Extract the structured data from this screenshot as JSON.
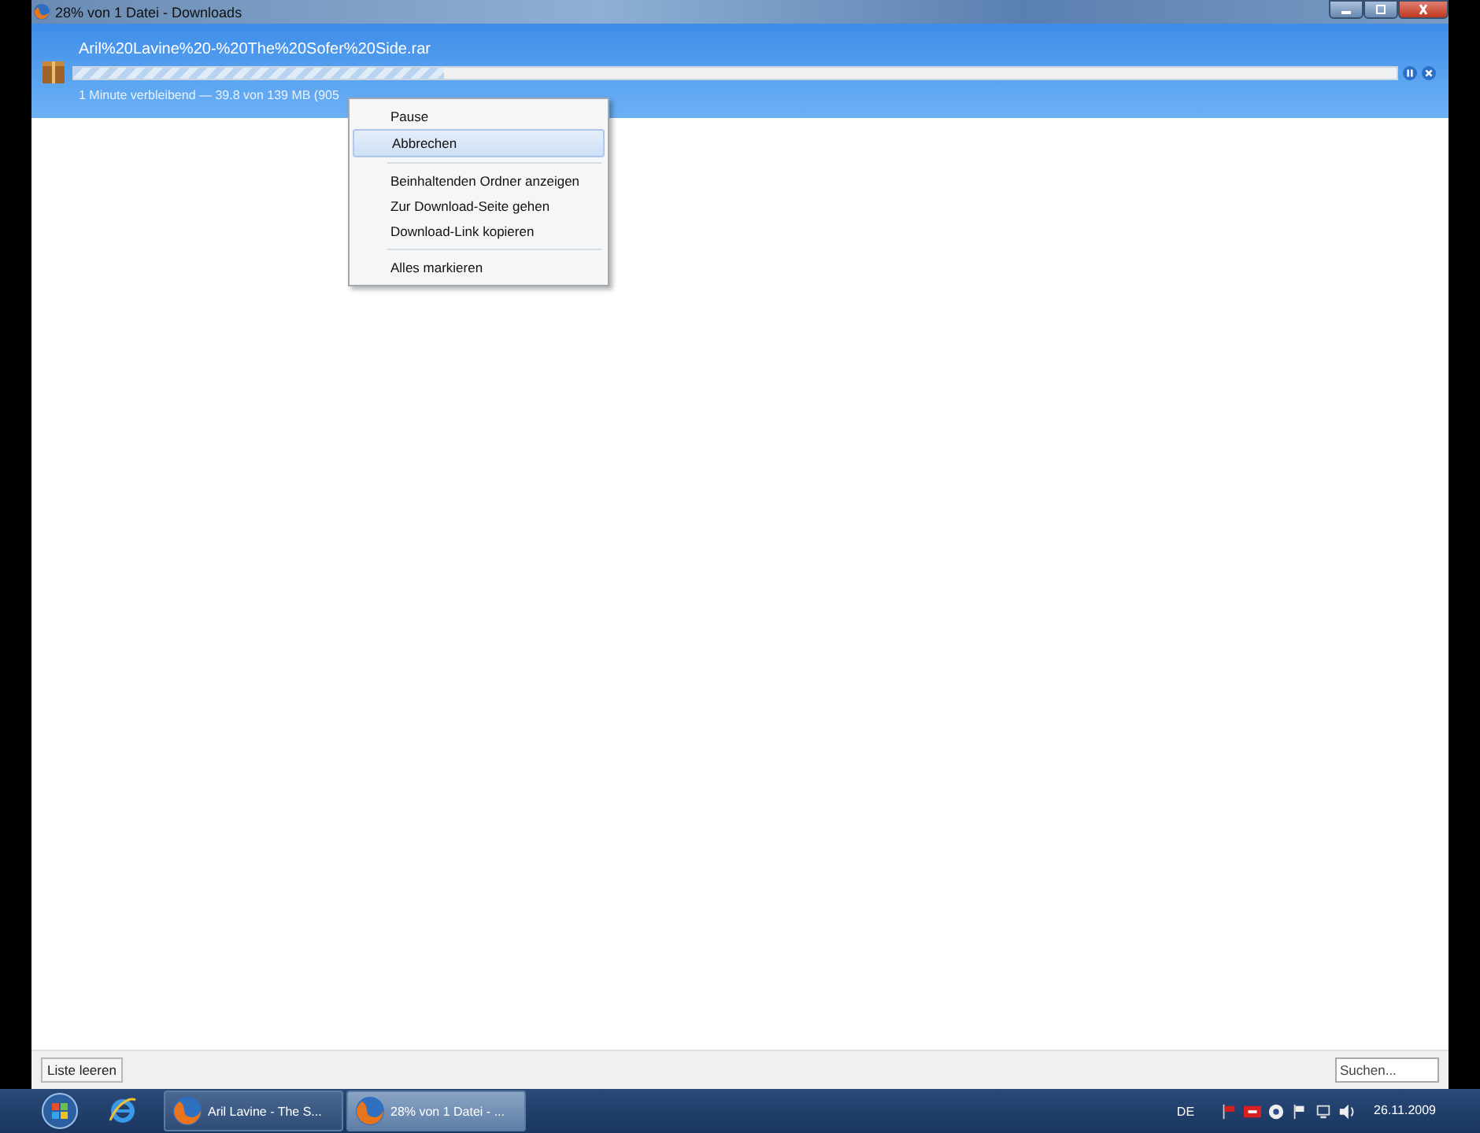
{
  "window": {
    "title": "28% von 1 Datei - Downloads"
  },
  "downloads": [
    {
      "filename": "Aril%20Lavine%20-%20The%20Sofer%20Side.rar",
      "level": 0.28,
      "status": "1 Minute verbleibend — 39.8 von 139 MB (905",
      "selected": true
    }
  ],
  "context_menu": {
    "groups": [
      [
        {
          "label": "Pause",
          "selected": false
        },
        {
          "label": "Abbrechen",
          "selected": true
        }
      ],
      [
        {
          "label": "Beinhaltenden Ordner anzeigen",
          "selected": false
        },
        {
          "label": "Zur Download-Seite gehen",
          "selected": false
        },
        {
          "label": "Download-Link kopieren",
          "selected": false
        }
      ],
      [
        {
          "label": "Alles markieren",
          "selected": false
        }
      ]
    ]
  },
  "footer": {
    "clear_button": "Liste leeren",
    "search": {
      "placeholder": "Suchen..."
    }
  },
  "taskbar": {
    "apps": [
      {
        "label": "Aril Lavine - The S...",
        "selected": false
      },
      {
        "label": "28% von 1 Datei - ...",
        "selected": true
      }
    ],
    "language": "DE",
    "date": "26.11.2009"
  }
}
